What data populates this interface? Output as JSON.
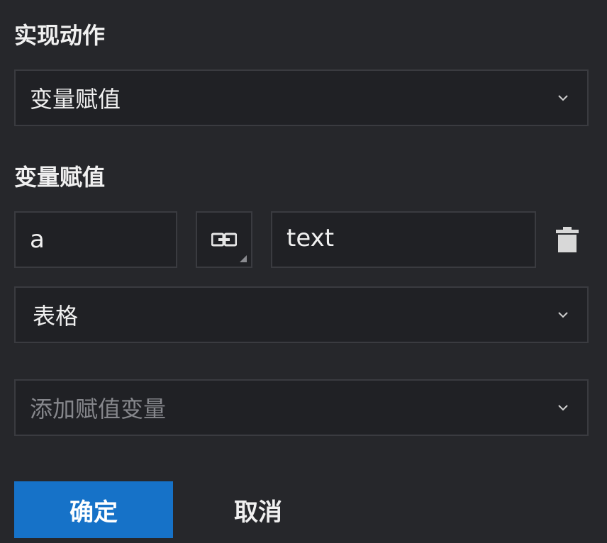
{
  "action_section": {
    "label": "实现动作",
    "select_value": "变量赋值"
  },
  "assign_section": {
    "label": "变量赋值",
    "variable_name": "a",
    "link_icon": "link-icon",
    "value_text": "text",
    "delete_icon": "trash-icon",
    "source_select_value": "表格"
  },
  "add_variable": {
    "placeholder": "添加赋值变量"
  },
  "footer": {
    "ok_label": "确定",
    "cancel_label": "取消"
  },
  "colors": {
    "background": "#26272b",
    "field_background": "#202125",
    "border": "#3a3b40",
    "primary": "#1672c8",
    "placeholder_text": "#86878c"
  }
}
